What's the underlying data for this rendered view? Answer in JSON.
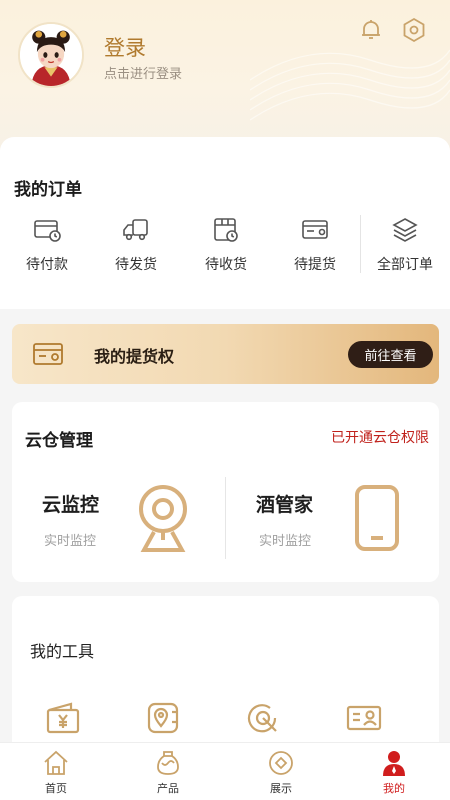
{
  "header": {
    "login_title": "登录",
    "login_subtitle": "点击进行登录",
    "icons": [
      "bell-icon",
      "settings-icon"
    ]
  },
  "orders": {
    "title": "我的订单",
    "items": [
      {
        "label": "待付款",
        "icon": "card-clock-icon"
      },
      {
        "label": "待发货",
        "icon": "truck-icon"
      },
      {
        "label": "待收货",
        "icon": "box-clock-icon"
      },
      {
        "label": "待提货",
        "icon": "voucher-icon"
      },
      {
        "label": "全部订单",
        "icon": "layers-icon"
      }
    ]
  },
  "pickup": {
    "label": "我的提货权",
    "button": "前往查看"
  },
  "cloud": {
    "title": "云仓管理",
    "status": "已开通云仓权限",
    "items": [
      {
        "name": "云监控",
        "sub": "实时监控",
        "icon": "webcam-icon"
      },
      {
        "name": "酒管家",
        "sub": "实时监控",
        "icon": "phone-icon"
      }
    ]
  },
  "tools": {
    "title": "我的工具",
    "icons": [
      "wallet-yen-icon",
      "location-card-icon",
      "refresh-circle-icon",
      "id-card-icon"
    ]
  },
  "tabbar": {
    "active": "我的",
    "items": [
      {
        "label": "首页",
        "icon": "home-icon"
      },
      {
        "label": "产品",
        "icon": "jar-icon"
      },
      {
        "label": "展示",
        "icon": "diamond-icon"
      },
      {
        "label": "我的",
        "icon": "user-icon"
      }
    ]
  },
  "colors": {
    "accent_gold": "#c9a36a",
    "status_red": "#c0221c",
    "pickup_button": "#2f1e16"
  }
}
